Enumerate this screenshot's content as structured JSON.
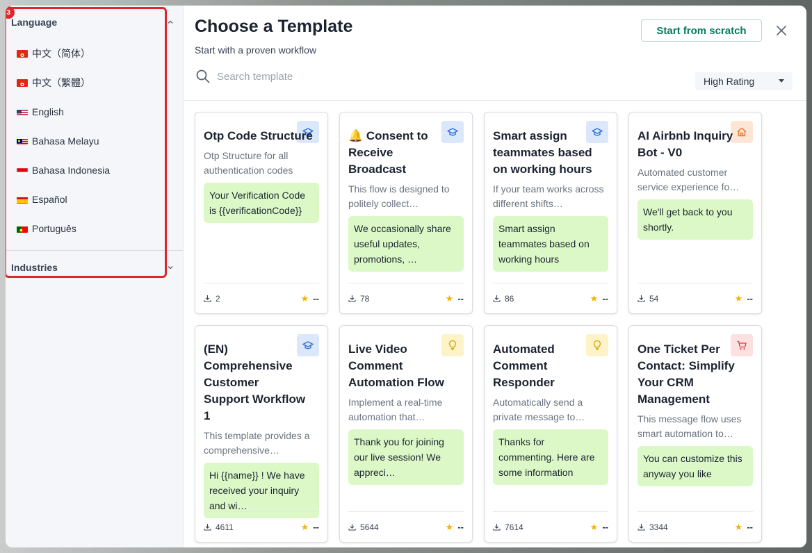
{
  "sidebar": {
    "annotation_badge": "3",
    "language": {
      "title": "Language",
      "items": [
        {
          "label": "中文（简体）",
          "flag": "hk"
        },
        {
          "label": "中文（繁體）",
          "flag": "hk"
        },
        {
          "label": "English",
          "flag": "us"
        },
        {
          "label": "Bahasa Melayu",
          "flag": "my"
        },
        {
          "label": "Bahasa Indonesia",
          "flag": "id"
        },
        {
          "label": "Español",
          "flag": "es"
        },
        {
          "label": "Português",
          "flag": "pt"
        }
      ]
    },
    "industries": {
      "title": "Industries"
    }
  },
  "header": {
    "title": "Choose a Template",
    "subtitle": "Start with a proven workflow",
    "scratch_label": "Start from scratch",
    "search_placeholder": "Search template",
    "sort_label": "High Rating"
  },
  "colors": {
    "accent": "#0b7a5f",
    "bubble": "#dcf8c6",
    "highlight": "#e0262d",
    "star": "#f5b301"
  },
  "cards": [
    {
      "title": "Otp Code Structure",
      "desc": "Otp Structure for all authentication codes",
      "bubble": "Your Verification Code is {{verificationCode}}",
      "downloads": "2",
      "rating": "--",
      "icon": "graduation-cap-icon"
    },
    {
      "title": "🔔 Consent to Receive Broadcast",
      "desc": "This flow is designed to politely collect…",
      "bubble": "We occasionally share useful updates, promotions, …",
      "downloads": "78",
      "rating": "--",
      "icon": "graduation-cap-icon"
    },
    {
      "title": "Smart assign teammates based on working hours",
      "desc": "If your team works across different shifts…",
      "bubble": "Smart assign teammates based on working hours",
      "downloads": "86",
      "rating": "--",
      "icon": "graduation-cap-icon"
    },
    {
      "title": "AI Airbnb Inquiry Bot - V0",
      "desc": "Automated customer service experience fo…",
      "bubble": "We'll get back to you shortly.",
      "downloads": "54",
      "rating": "--",
      "icon": "home-icon"
    },
    {
      "title": "(EN) Comprehensive Customer Support Workflow 1",
      "desc": "This template provides a comprehensive…",
      "bubble": "Hi {{name}} ! We have received your inquiry and wi…",
      "downloads": "4611",
      "rating": "--",
      "icon": "graduation-cap-icon"
    },
    {
      "title": "Live Video Comment Automation Flow",
      "desc": "Implement a real-time automation that…",
      "bubble": "Thank you for joining our live session! We appreci…",
      "downloads": "5644",
      "rating": "--",
      "icon": "lightbulb-icon"
    },
    {
      "title": "Automated Comment Responder",
      "desc": "Automatically send a private message to…",
      "bubble": "Thanks for commenting. Here are some information",
      "downloads": "7614",
      "rating": "--",
      "icon": "lightbulb-icon"
    },
    {
      "title": "One Ticket Per Contact: Simplify Your CRM Management",
      "desc": "This message flow uses smart automation to…",
      "bubble": "You can customize this anyway you like",
      "downloads": "3344",
      "rating": "--",
      "icon": "cart-icon"
    }
  ]
}
